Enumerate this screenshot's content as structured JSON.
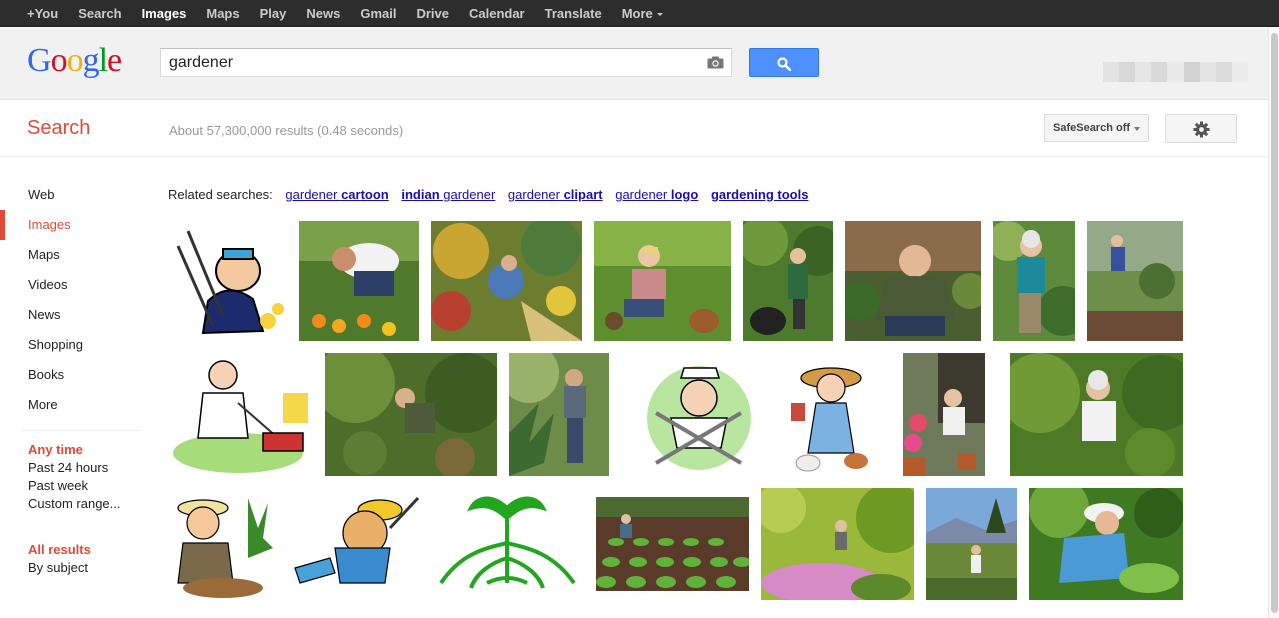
{
  "topnav": [
    {
      "label": "+You",
      "active": false
    },
    {
      "label": "Search",
      "active": false
    },
    {
      "label": "Images",
      "active": true
    },
    {
      "label": "Maps",
      "active": false
    },
    {
      "label": "Play",
      "active": false
    },
    {
      "label": "News",
      "active": false
    },
    {
      "label": "Gmail",
      "active": false
    },
    {
      "label": "Drive",
      "active": false
    },
    {
      "label": "Calendar",
      "active": false
    },
    {
      "label": "Translate",
      "active": false
    },
    {
      "label": "More",
      "active": false
    }
  ],
  "logo": {
    "letters": [
      "G",
      "o",
      "o",
      "g",
      "l",
      "e"
    ]
  },
  "search": {
    "query": "gardener",
    "camera_icon": "camera-icon",
    "button_icon": "search-icon"
  },
  "results": {
    "label": "Search",
    "stats": "About 57,300,000 results (0.48 seconds)"
  },
  "safesearch": {
    "label": "SafeSearch off"
  },
  "settings": {
    "icon": "gear-icon"
  },
  "sidebar": {
    "items": [
      {
        "label": "Web",
        "active": false
      },
      {
        "label": "Images",
        "active": true
      },
      {
        "label": "Maps",
        "active": false
      },
      {
        "label": "Videos",
        "active": false
      },
      {
        "label": "News",
        "active": false
      },
      {
        "label": "Shopping",
        "active": false
      },
      {
        "label": "Books",
        "active": false
      },
      {
        "label": "More",
        "active": false
      }
    ],
    "time_heading": "Any time",
    "time_options": [
      "Past 24 hours",
      "Past week",
      "Custom range..."
    ],
    "results_heading": "All results",
    "results_options": [
      "By subject"
    ]
  },
  "related": {
    "label": "Related searches:",
    "links": [
      {
        "plain": "gardener ",
        "bold": "cartoon"
      },
      {
        "plain": "",
        "bold": "indian",
        "plain2": " gardener"
      },
      {
        "plain": "gardener ",
        "bold": "clipart"
      },
      {
        "plain": "gardener ",
        "bold": "logo"
      },
      {
        "plain": "",
        "bold": "gardening tools"
      }
    ]
  },
  "colors": {
    "accent_red": "#dd4b39",
    "link": "#1a0dab",
    "search_blue": "#4d90fe"
  }
}
